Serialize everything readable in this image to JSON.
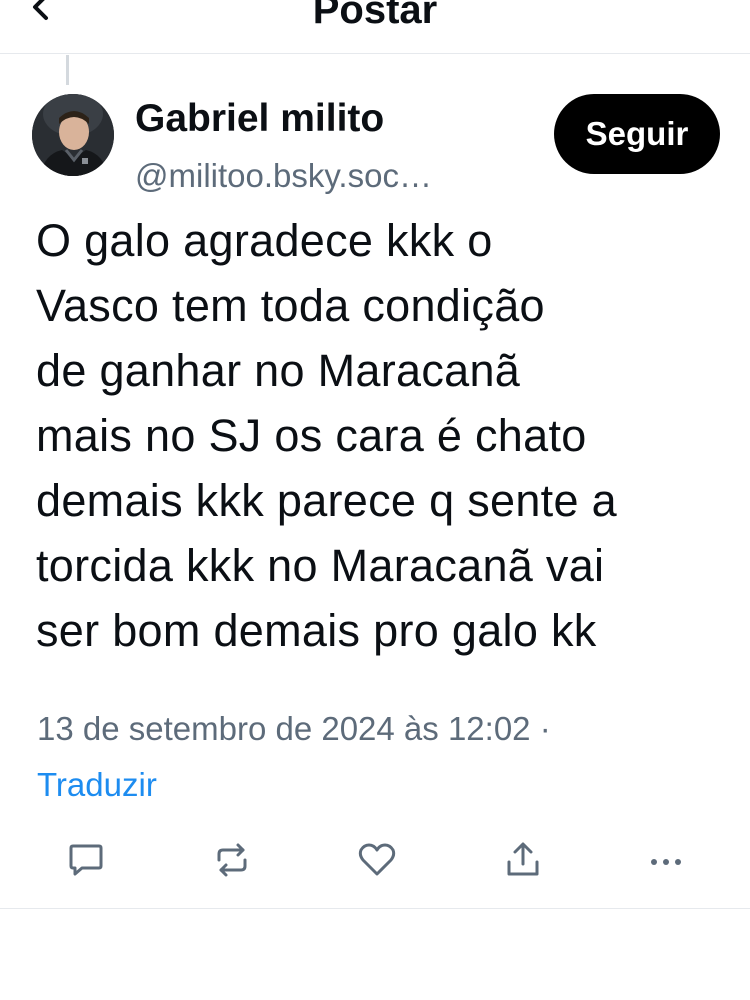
{
  "header": {
    "title": "Postar",
    "back_icon": "chevron-left-icon"
  },
  "author": {
    "name": "Gabriel milito",
    "handle": "@militoo.bsky.soc…",
    "avatar_icon": "user-avatar"
  },
  "follow_button": {
    "label": "Seguir"
  },
  "post": {
    "text": "O galo agradece kkk o\nVasco tem toda condição\nde ganhar no Maracanã\nmais no SJ os cara é chato\ndemais kkk parece q sente a\ntorcida kkk no Maracanã vai\nser bom demais pro galo kk",
    "timestamp": "13 de setembro de 2024 às 12:02 ·",
    "translate_label": "Traduzir"
  },
  "actions": [
    {
      "icon": "reply-icon"
    },
    {
      "icon": "repost-icon"
    },
    {
      "icon": "like-icon"
    },
    {
      "icon": "share-icon"
    },
    {
      "icon": "more-icon"
    }
  ],
  "colors": {
    "text_primary": "#0b0f14",
    "text_secondary": "#5d6b7a",
    "link": "#1d8cf0",
    "follow_bg": "#000000",
    "icon": "#5d6b7a",
    "divider": "#e6e9ed"
  }
}
